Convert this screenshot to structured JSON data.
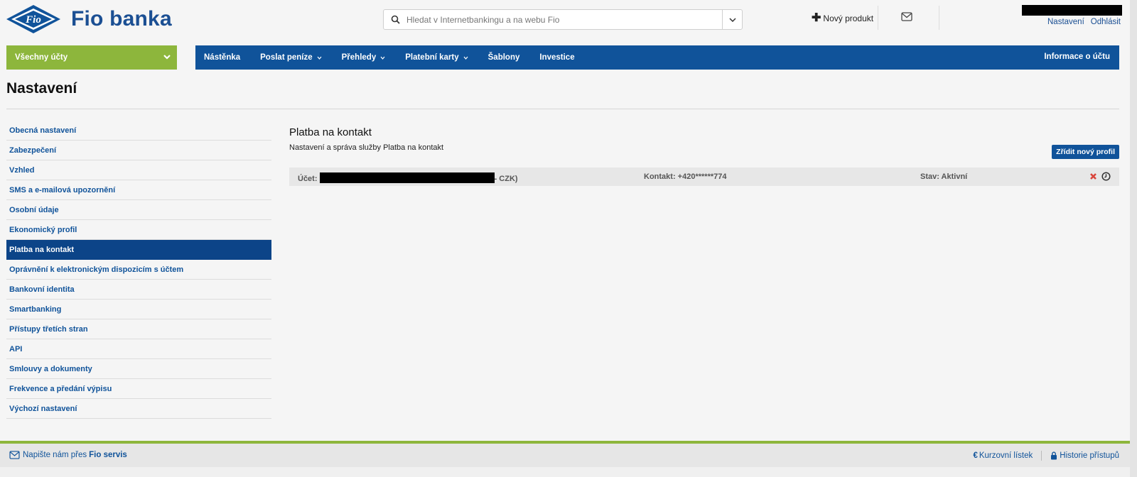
{
  "brand": {
    "name": "Fio banka",
    "logo_text": "Fio"
  },
  "search": {
    "placeholder": "Hledat v Internetbankingu a na webu Fio"
  },
  "header": {
    "new_product": "Nový produkt",
    "settings_link": "Nastavení",
    "logout_link": "Odhlásit"
  },
  "accounts_dropdown": {
    "label": "Všechny účty"
  },
  "nav": {
    "items": [
      {
        "label": "Nástěnka",
        "dropdown": false
      },
      {
        "label": "Poslat peníze",
        "dropdown": true
      },
      {
        "label": "Přehledy",
        "dropdown": true
      },
      {
        "label": "Platební karty",
        "dropdown": true
      },
      {
        "label": "Šablony",
        "dropdown": false
      },
      {
        "label": "Investice",
        "dropdown": false
      }
    ],
    "right": "Informace o účtu"
  },
  "page": {
    "title": "Nastavení"
  },
  "sidebar": {
    "items": [
      {
        "label": "Obecná nastavení",
        "active": false
      },
      {
        "label": "Zabezpečení",
        "active": false
      },
      {
        "label": "Vzhled",
        "active": false
      },
      {
        "label": "SMS a e-mailová upozornění",
        "active": false
      },
      {
        "label": "Osobní údaje",
        "active": false
      },
      {
        "label": "Ekonomický profil",
        "active": false
      },
      {
        "label": "Platba na kontakt",
        "active": true
      },
      {
        "label": "Oprávnění k elektronickým dispozicím s účtem",
        "active": false
      },
      {
        "label": "Bankovní identita",
        "active": false
      },
      {
        "label": "Smartbanking",
        "active": false
      },
      {
        "label": "Přístupy třetích stran",
        "active": false
      },
      {
        "label": "API",
        "active": false
      },
      {
        "label": "Smlouvy a dokumenty",
        "active": false
      },
      {
        "label": "Frekvence a předání výpisu",
        "active": false
      },
      {
        "label": "Výchozí nastavení",
        "active": false
      }
    ]
  },
  "main": {
    "title": "Platba na kontakt",
    "subtitle": "Nastavení a správa služby Platba na kontakt",
    "create_button": "Zřídit nový profil",
    "profile": {
      "account_label": "Účet: ",
      "account_suffix": "- CZK)",
      "contact": "Kontakt: +420******774",
      "status": "Stav: Aktivní"
    }
  },
  "footer": {
    "contact_prefix": "Napište nám přes",
    "contact_link": "Fio servis",
    "exchange_rates": "Kurzovní lístek",
    "access_history": "Historie přístupů"
  },
  "colors": {
    "primary_blue": "#10539a",
    "active_blue": "#0c4488",
    "accent_green": "#8db63c",
    "delete_red": "#d9453b"
  },
  "icons": [
    "fio-logo",
    "search-icon",
    "chevron-down-icon",
    "plus-icon",
    "envelope-icon",
    "delete-icon",
    "clock-icon",
    "euro-icon",
    "lock-icon"
  ]
}
